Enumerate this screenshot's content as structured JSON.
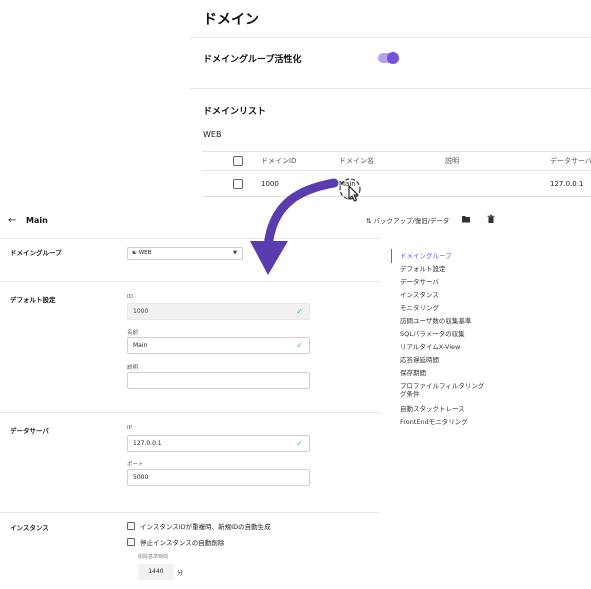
{
  "top": {
    "title": "ドメイン",
    "toggle_label": "ドメイングループ活性化",
    "toggle_on": true,
    "list_title": "ドメインリスト",
    "group_name": "WEB",
    "columns": [
      "ドメインID",
      "ドメイン名",
      "説明",
      "データサーバ"
    ],
    "rows": [
      {
        "id": "1000",
        "name": "Main",
        "description": "",
        "server": "127.0.0.1"
      }
    ]
  },
  "detail": {
    "title": "Main",
    "backup_label": "バックアップ/復旧/データ",
    "domain_group": {
      "label": "ドメイングループ",
      "value": "WEB"
    },
    "default": {
      "label": "デフォルト設定",
      "id_label": "ID",
      "id_value": "1000",
      "name_label": "名前",
      "name_value": "Main",
      "desc_label": "説明",
      "desc_value": ""
    },
    "data_server": {
      "label": "データサーバ",
      "ip_label": "IP",
      "ip_value": "127.0.0.1",
      "port_label": "ポート",
      "port_value": "5000"
    },
    "instance": {
      "label": "インスタンス",
      "opt1": "インスタンスIDが重複時、新規IDの自動生成",
      "opt2": "停止インスタンスの自動削除",
      "criteria_label": "削除基準時間",
      "minutes": "1440",
      "unit": "分"
    },
    "nav": [
      "ドメイングループ",
      "デフォルト設定",
      "データサーバ",
      "インスタンス",
      "モニタリング",
      "訪問ユーザ数の収集基準",
      "SQLパラメータの収集",
      "リアルタイムX-View",
      "応答遅延時間",
      "保存期間",
      "プロファイルフィルタリング",
      "グ条件",
      "自動スタックトレース",
      "FrontEndモニタリング"
    ]
  },
  "colors": {
    "accent": "#7a4fe0",
    "toggle_track": "#b8a3ea",
    "check": "#34c07a",
    "arrow": "#5b3bb0"
  }
}
